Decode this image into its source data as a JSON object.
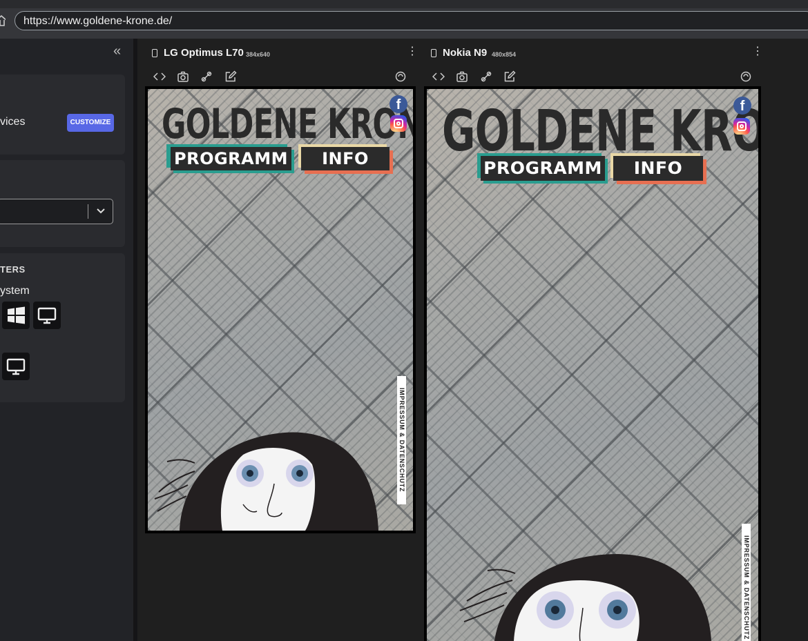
{
  "browser": {
    "url": "https://www.goldene-krone.de/"
  },
  "sidebar": {
    "devices_label": "vices",
    "customize_label": "CUSTOMIZE",
    "filters_label": "TERS",
    "os_label": "ystem"
  },
  "devices": [
    {
      "name": "LG Optimus L70",
      "resolution": "384x640",
      "site": {
        "logo": "GOLDENE KRONE",
        "nav_programm": "PROGRAMM",
        "nav_info": "INFO",
        "footer": "IMPRESSUM & DATENSCHUTZ",
        "facebook": "f"
      }
    },
    {
      "name": "Nokia N9",
      "resolution": "480x854",
      "site": {
        "logo": "GOLDENE KRONE",
        "nav_programm": "PROGRAMM",
        "nav_info": "INFO",
        "footer": "IMPRESSUM & DATENSCHUTZ",
        "facebook": "f"
      }
    }
  ],
  "colors": {
    "accent": "#5868e6",
    "programm_border": "#2a9d8f",
    "info_border": "#e76f51",
    "info_border_top": "#e9d8a6"
  }
}
